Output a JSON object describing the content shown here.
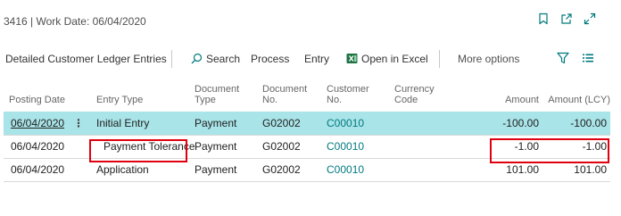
{
  "window": {
    "title": "3416 | Work Date: 06/04/2020"
  },
  "actionbar": {
    "part_title": "Detailed Customer Ledger Entries",
    "search": "Search",
    "process": "Process",
    "entry": "Entry",
    "open_in_excel": "Open in Excel",
    "more_options": "More options"
  },
  "table": {
    "headers": {
      "posting_date": "Posting Date",
      "entry_type": "Entry Type",
      "document_type_1": "Document",
      "document_type_2": "Type",
      "document_no_1": "Document",
      "document_no_2": "No.",
      "customer_no_1": "Customer",
      "customer_no_2": "No.",
      "currency_code_1": "Currency",
      "currency_code_2": "Code",
      "amount": "Amount",
      "amount_lcy": "Amount (LCY)"
    },
    "rows": [
      {
        "posting_date": "06/04/2020",
        "entry_type": "Initial Entry",
        "document_type": "Payment",
        "document_no": "G02002",
        "customer_no": "C00010",
        "currency_code": "",
        "amount": "-100.00",
        "amount_lcy": "-100.00"
      },
      {
        "posting_date": "06/04/2020",
        "entry_type": "Payment Tolerance",
        "document_type": "Payment",
        "document_no": "G02002",
        "customer_no": "C00010",
        "currency_code": "",
        "amount": "-1.00",
        "amount_lcy": "-1.00"
      },
      {
        "posting_date": "06/04/2020",
        "entry_type": "Application",
        "document_type": "Payment",
        "document_no": "G02002",
        "customer_no": "C00010",
        "currency_code": "",
        "amount": "101.00",
        "amount_lcy": "101.00"
      }
    ]
  },
  "colors": {
    "selected_row": "#a9e4e8",
    "link": "#00797d",
    "highlight": "#e0000f",
    "excel_green": "#1f7244"
  }
}
